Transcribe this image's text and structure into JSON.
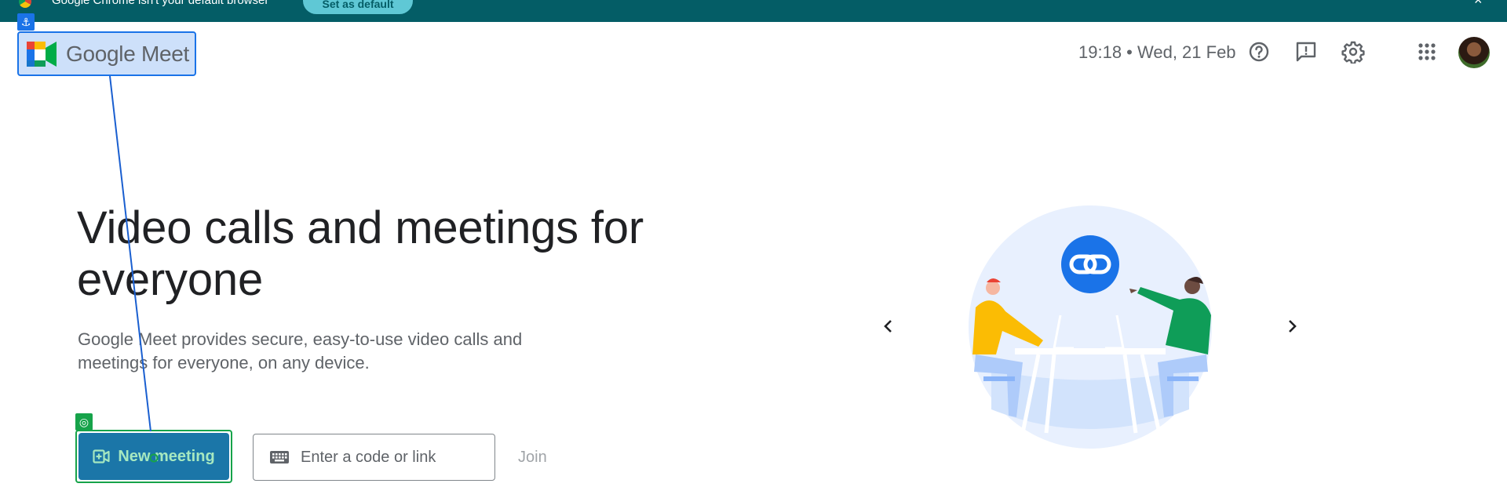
{
  "banner": {
    "text": "Google Chrome isn't your default browser",
    "button_label": "Set as default",
    "close_glyph": "×"
  },
  "header": {
    "logo_text_google": "Google",
    "logo_text_meet": "Meet",
    "datetime": "19:18 • Wed, 21 Feb",
    "icons": [
      "help-icon",
      "feedback-icon",
      "settings-icon",
      "apps-grid-icon",
      "avatar"
    ]
  },
  "hero": {
    "headline": "Video calls and meetings for everyone",
    "subtext": "Google Meet provides secure, easy-to-use video calls and meetings for everyone, on any device.",
    "new_meeting_label": "New meeting",
    "code_placeholder": "Enter a code or link",
    "join_label": "Join"
  },
  "carousel": {
    "prev_icon": "chevron-left-icon",
    "next_icon": "chevron-right-icon",
    "illustration": "link-sharing-illustration"
  },
  "colors": {
    "banner_bg": "#045d66",
    "primary_blue": "#1a73e8",
    "highlight_green": "#16a34a",
    "text_primary": "#202124",
    "text_secondary": "#5f6368"
  }
}
